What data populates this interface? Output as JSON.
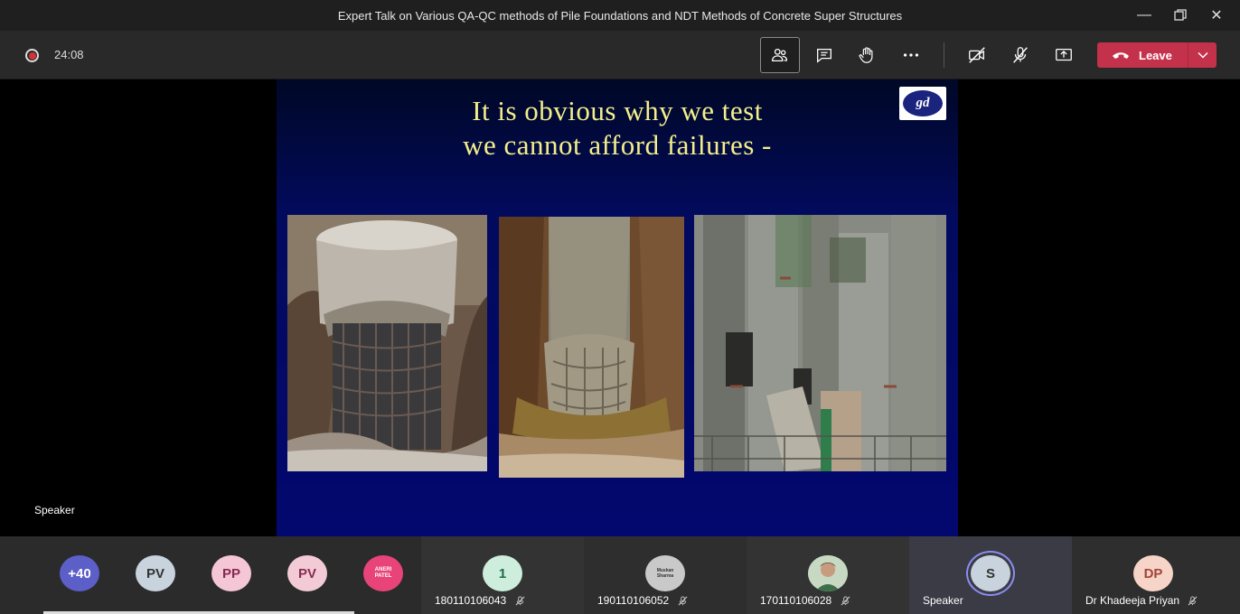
{
  "window": {
    "title": "Expert Talk on Various QA-QC methods of Pile Foundations and NDT Methods of Concrete Super Structures"
  },
  "call": {
    "timer": "24:08",
    "leave_label": "Leave"
  },
  "slide": {
    "line1": "It is obvious why we test",
    "line2": "we cannot afford failures -",
    "logo_text": "gd"
  },
  "stage": {
    "speaker_label": "Speaker"
  },
  "participants": {
    "overflow": "+40",
    "avatars": [
      {
        "initials": "PV",
        "color": "#c8d3dd"
      },
      {
        "initials": "PP",
        "color": "#f4c6d6"
      },
      {
        "initials": "PV",
        "color": "#f2cbd6"
      },
      {
        "initials": "ANERI PATEL",
        "color": "#e8447a"
      }
    ],
    "tiles": [
      {
        "avatar": "1",
        "name": "180110106043",
        "color": "#cdeedc"
      },
      {
        "avatar": "Muskan Sharma",
        "name": "190110106052",
        "color": "#c9c9c9"
      },
      {
        "avatar": "",
        "name": "170110106028",
        "color": "#9ecb9a"
      },
      {
        "avatar": "S",
        "name": "Speaker",
        "color": "#c8d3dd"
      },
      {
        "avatar": "DP",
        "name": "Dr Khadeeja Priyan",
        "color": "#f7d4c8"
      }
    ]
  }
}
